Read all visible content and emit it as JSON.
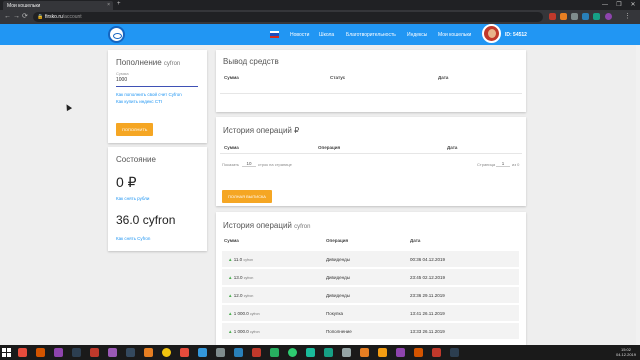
{
  "browser": {
    "tab_title": "Мои кошельки",
    "tab_close": "×",
    "new_tab": "+",
    "url_host": "firsko.ru",
    "url_path": "/account",
    "window_controls": [
      "—",
      "❐",
      "✕"
    ]
  },
  "header": {
    "menu": [
      "Новости",
      "Школа",
      "Благотворительность",
      "Индексы",
      "Мои кошельки"
    ],
    "user_id": "ID: 54512"
  },
  "topup": {
    "title": "Пополнение",
    "title_unit": "cyfron",
    "amount_label": "Сумма",
    "amount_value": "1000",
    "links": [
      "Как пополнить свой счет Cyfron",
      "Как купить индекс CTI"
    ],
    "button": "ПОПОЛНИТЬ"
  },
  "status": {
    "title": "Состояние",
    "rub_balance": "0 ₽",
    "rub_link": "Как снять рубли",
    "cyfron_balance": "36.0 cyfron",
    "cyfron_link": "Как снять Cyfron"
  },
  "withdraw": {
    "title": "Вывод средств",
    "columns": [
      "Сумма",
      "Статус",
      "Дата"
    ]
  },
  "rub_history": {
    "title": "История операций ₽",
    "columns": [
      "Сумма",
      "Операция",
      "Дата"
    ],
    "show_label": "Показать",
    "per_page": "10",
    "per_page_suffix": "строк на странице",
    "page_label": "Страница",
    "page": "1",
    "page_of": "из 0",
    "button": "ПОЛНАЯ ВЫПИСКА"
  },
  "cyfron_history": {
    "title": "История операций",
    "title_unit": "cyfron",
    "columns": [
      "Сумма",
      "Операция",
      "Дата"
    ],
    "rows": [
      {
        "amount": "11.0",
        "unit": "cyfron",
        "op": "Дивиденды",
        "date": "00:36 04.12.2019"
      },
      {
        "amount": "13.0",
        "unit": "cyfron",
        "op": "Дивиденды",
        "date": "23:45 02.12.2019"
      },
      {
        "amount": "12.0",
        "unit": "cyfron",
        "op": "Дивиденды",
        "date": "23:36 29.11.2019"
      },
      {
        "amount": "1 000.0",
        "unit": "cyfron",
        "op": "Покупка",
        "date": "13:41 26.11.2019"
      },
      {
        "amount": "1 000.0",
        "unit": "cyfron",
        "op": "Пополнение",
        "date": "13:33 26.11.2019"
      }
    ]
  },
  "taskbar": {
    "time": "15:02",
    "date": "04.12.2019"
  },
  "colors": {
    "header_blue": "#2196f3",
    "accent_orange": "#f5a623",
    "link_blue": "#2196f3"
  }
}
